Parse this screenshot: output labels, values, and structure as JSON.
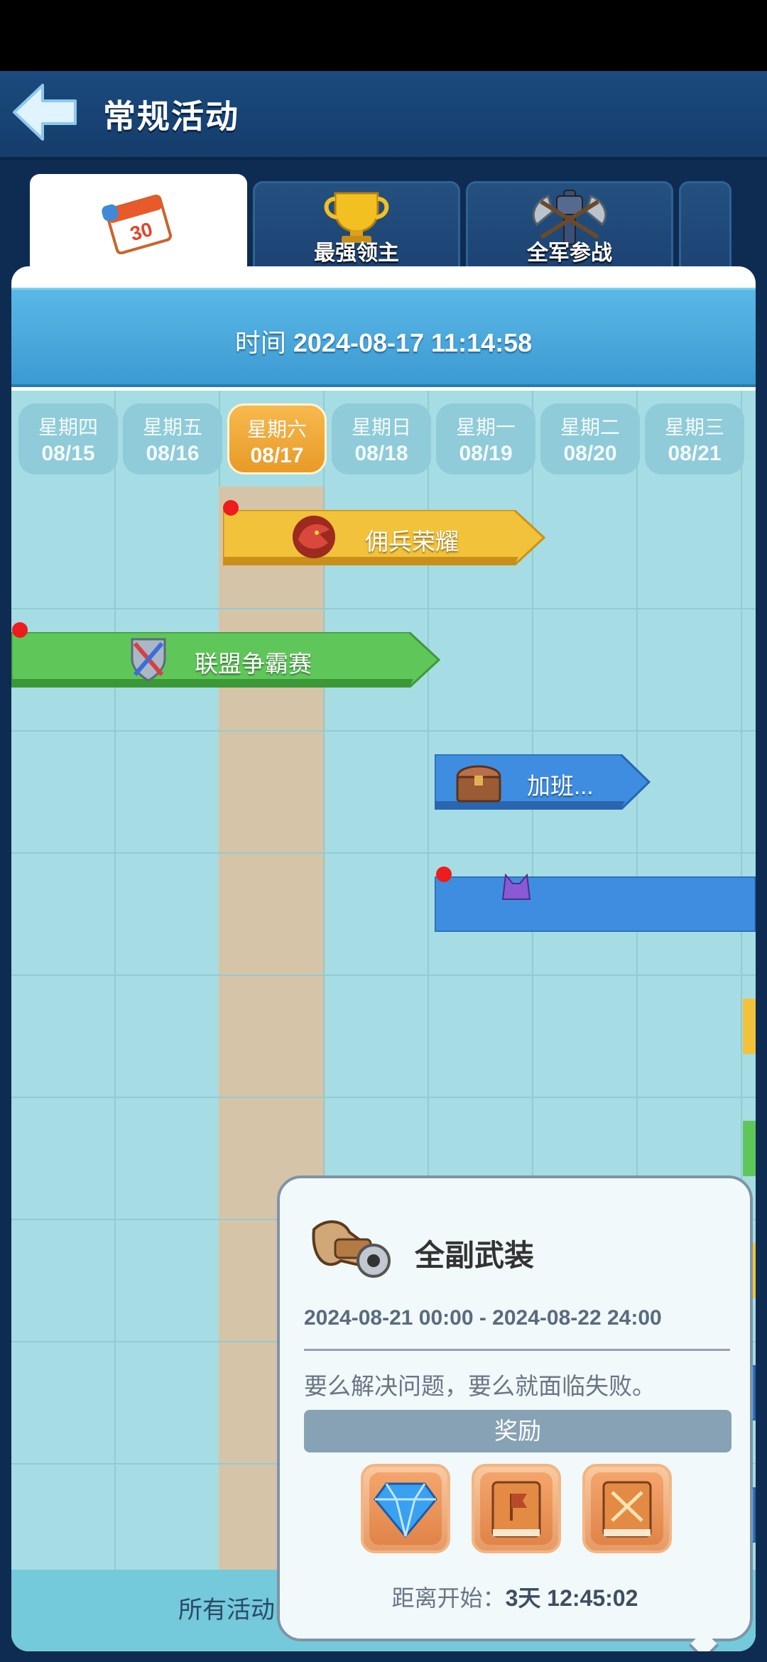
{
  "header": {
    "title": "常规活动"
  },
  "tabs": [
    {
      "label": "",
      "icon": "calendar-icon",
      "calendar_number": "30",
      "active": true
    },
    {
      "label": "最强领主",
      "icon": "trophy-icon"
    },
    {
      "label": "全军参战",
      "icon": "crossed-axes-icon"
    },
    {
      "label": "",
      "icon": "more-tab"
    }
  ],
  "time": {
    "label": "时间",
    "value": "2024-08-17 11:14:58"
  },
  "days": [
    {
      "weekday": "星期四",
      "date": "08/15"
    },
    {
      "weekday": "星期五",
      "date": "08/16"
    },
    {
      "weekday": "星期六",
      "date": "08/17",
      "active": true
    },
    {
      "weekday": "星期日",
      "date": "08/18"
    },
    {
      "weekday": "星期一",
      "date": "08/19"
    },
    {
      "weekday": "星期二",
      "date": "08/20"
    },
    {
      "weekday": "星期三",
      "date": "08/21"
    }
  ],
  "events": [
    {
      "label": "佣兵荣耀",
      "icon": "eagle-emblem-icon",
      "color": "#f2c23a",
      "has_dot": true
    },
    {
      "label": "联盟争霸赛",
      "icon": "crossed-swords-shield-icon",
      "color": "#5fc75a",
      "has_dot": true
    },
    {
      "label": "加班...",
      "icon": "treasure-chest-icon",
      "color": "#3f8de0",
      "has_dot": false
    },
    {
      "label": "",
      "icon": "purple-demon-icon",
      "color": "#3f8de0",
      "has_dot": true
    },
    {
      "label": "",
      "icon": "crossbow-icon",
      "color": "#3f8de0",
      "has_dot": false
    },
    {
      "label": "",
      "icon": "lion-head-icon",
      "color": "#3f8de0",
      "has_dot": true
    }
  ],
  "popup": {
    "title": "全副武装",
    "icon": "crossbow-icon",
    "range": "2024-08-21 00:00 - 2024-08-22 24:00",
    "description": "要么解决问题，要么就面临失败。",
    "reward_label": "奖励",
    "rewards": [
      {
        "icon": "blue-diamond-icon"
      },
      {
        "icon": "flag-book-icon"
      },
      {
        "icon": "sword-book-icon"
      }
    ],
    "countdown_label": "距离开始：",
    "countdown_value": "3天 12:45:02"
  },
  "footer": {
    "note": "所有活动的最终开放情况以游戏内为准"
  },
  "colors": {
    "accent": "#f0a735",
    "header": "#1b4a7e",
    "grid": "#a6dde4"
  }
}
